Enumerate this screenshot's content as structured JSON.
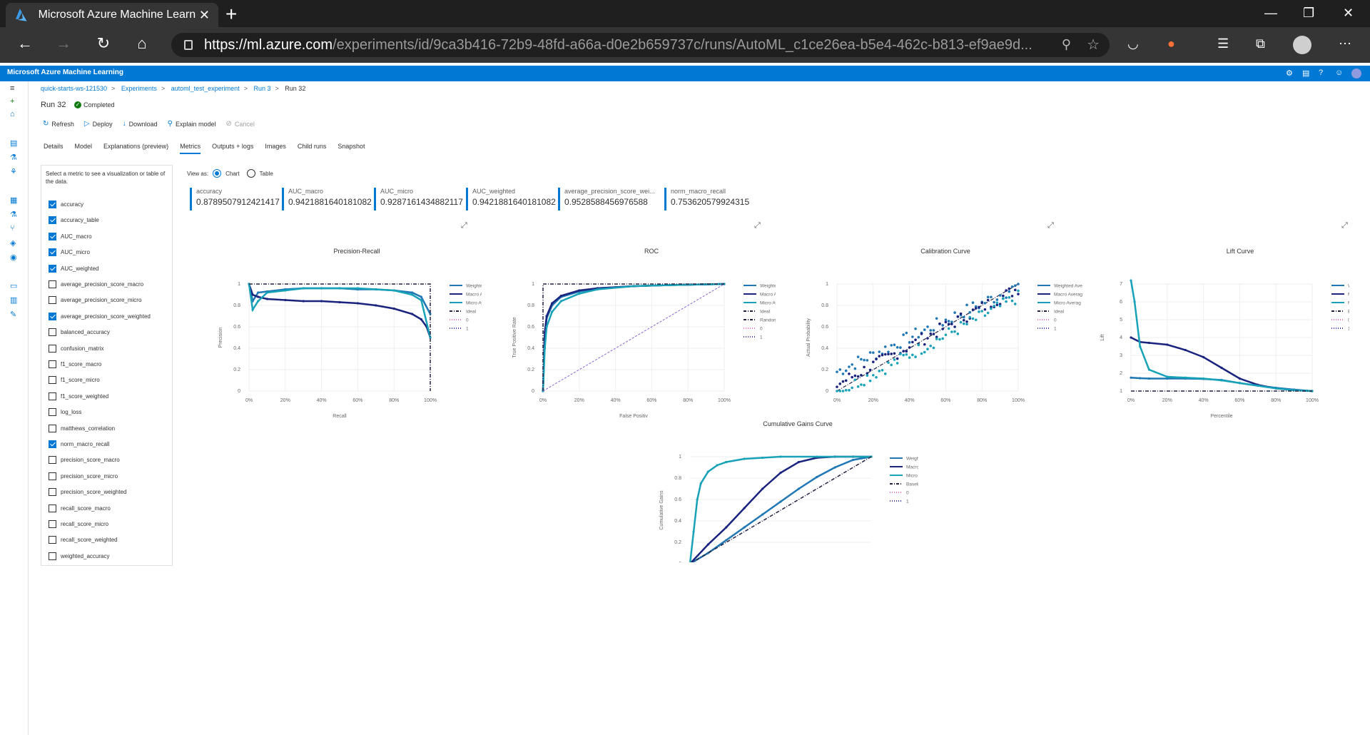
{
  "browser": {
    "tab_title": "Microsoft Azure Machine Learni",
    "url_host": "https://ml.azure.com",
    "url_path": "/experiments/id/9ca3b416-72b9-48fd-a66a-d0e2b659737c/runs/AutoML_c1ce26ea-b5e4-462c-b813-ef9ae9d..."
  },
  "header": {
    "brand": "Microsoft Azure Machine Learning"
  },
  "breadcrumb": [
    "quick-starts-ws-121530",
    "Experiments",
    "automl_test_experiment",
    "Run 3",
    "Run 32"
  ],
  "run": {
    "title": "Run 32",
    "status": "Completed"
  },
  "actions": {
    "refresh": "Refresh",
    "deploy": "Deploy",
    "download": "Download",
    "explain": "Explain model",
    "cancel": "Cancel"
  },
  "tabs": [
    "Details",
    "Model",
    "Explanations (preview)",
    "Metrics",
    "Outputs + logs",
    "Images",
    "Child runs",
    "Snapshot"
  ],
  "metrics_panel": {
    "description": "Select a metric to see a visualization or table of the data.",
    "items": [
      {
        "label": "accuracy",
        "checked": true
      },
      {
        "label": "accuracy_table",
        "checked": true
      },
      {
        "label": "AUC_macro",
        "checked": true
      },
      {
        "label": "AUC_micro",
        "checked": true
      },
      {
        "label": "AUC_weighted",
        "checked": true
      },
      {
        "label": "average_precision_score_macro",
        "checked": false
      },
      {
        "label": "average_precision_score_micro",
        "checked": false
      },
      {
        "label": "average_precision_score_weighted",
        "checked": true
      },
      {
        "label": "balanced_accuracy",
        "checked": false
      },
      {
        "label": "confusion_matrix",
        "checked": false
      },
      {
        "label": "f1_score_macro",
        "checked": false
      },
      {
        "label": "f1_score_micro",
        "checked": false
      },
      {
        "label": "f1_score_weighted",
        "checked": false
      },
      {
        "label": "log_loss",
        "checked": false
      },
      {
        "label": "matthews_correlation",
        "checked": false
      },
      {
        "label": "norm_macro_recall",
        "checked": true
      },
      {
        "label": "precision_score_macro",
        "checked": false
      },
      {
        "label": "precision_score_micro",
        "checked": false
      },
      {
        "label": "precision_score_weighted",
        "checked": false
      },
      {
        "label": "recall_score_macro",
        "checked": false
      },
      {
        "label": "recall_score_micro",
        "checked": false
      },
      {
        "label": "recall_score_weighted",
        "checked": false
      },
      {
        "label": "weighted_accuracy",
        "checked": false
      }
    ]
  },
  "view_as": {
    "label": "View as:",
    "chart": "Chart",
    "table": "Table",
    "selected": "Chart"
  },
  "metric_cards": [
    {
      "name": "accuracy",
      "value": "0.8789507912421417"
    },
    {
      "name": "AUC_macro",
      "value": "0.9421881640181082"
    },
    {
      "name": "AUC_micro",
      "value": "0.9287161434882117"
    },
    {
      "name": "AUC_weighted",
      "value": "0.9421881640181082"
    },
    {
      "name": "average_precision_score_wei...",
      "value": "0.9528588456976588"
    },
    {
      "name": "norm_macro_recall",
      "value": "0.753620579924315"
    }
  ],
  "colors": {
    "accent": "#0078d4",
    "weighted": "#1f77b4",
    "macro": "#1a237e",
    "micro": "#17a2b8",
    "baseline": "#222244",
    "zero": "#e377c2",
    "one": "#3f3f9f"
  },
  "chart_data": [
    {
      "type": "line",
      "title": "Precision-Recall",
      "xlabel": "Recall",
      "ylabel": "Precision",
      "x_ticks": [
        "0%",
        "20%",
        "40%",
        "60%",
        "80%",
        "100%"
      ],
      "y_ticks": [
        "0",
        "0.2",
        "0.4",
        "0.6",
        "0.8",
        "1"
      ],
      "legend": [
        "Weighted Ave",
        "Macro Averag",
        "Micro Averag",
        "Ideal",
        "0",
        "1"
      ],
      "series": [
        {
          "name": "Weighted Ave",
          "x": [
            0,
            0.02,
            0.05,
            0.1,
            0.2,
            0.3,
            0.4,
            0.5,
            0.6,
            0.7,
            0.8,
            0.9,
            0.95,
            1.0
          ],
          "y": [
            1,
            0.84,
            0.92,
            0.93,
            0.95,
            0.96,
            0.96,
            0.96,
            0.95,
            0.95,
            0.94,
            0.92,
            0.88,
            0.72
          ]
        },
        {
          "name": "Macro Averag",
          "x": [
            0,
            0.02,
            0.05,
            0.1,
            0.2,
            0.3,
            0.4,
            0.5,
            0.6,
            0.7,
            0.8,
            0.9,
            0.95,
            0.98,
            1.0
          ],
          "y": [
            1,
            0.9,
            0.88,
            0.86,
            0.85,
            0.84,
            0.84,
            0.83,
            0.82,
            0.8,
            0.77,
            0.72,
            0.67,
            0.6,
            0.5
          ]
        },
        {
          "name": "Micro Averag",
          "x": [
            0,
            0.02,
            0.05,
            0.1,
            0.2,
            0.3,
            0.4,
            0.5,
            0.6,
            0.7,
            0.8,
            0.9,
            0.95,
            1.0
          ],
          "y": [
            1,
            0.76,
            0.84,
            0.92,
            0.94,
            0.96,
            0.96,
            0.96,
            0.96,
            0.95,
            0.94,
            0.9,
            0.85,
            0.5
          ]
        },
        {
          "name": "Ideal",
          "x": [
            0,
            1,
            1
          ],
          "y": [
            1,
            1,
            0
          ]
        }
      ]
    },
    {
      "type": "line",
      "title": "ROC",
      "xlabel": "False Positiv",
      "ylabel": "True Positive Rate",
      "x_ticks": [
        "0%",
        "20%",
        "40%",
        "60%",
        "80%",
        "100%"
      ],
      "y_ticks": [
        "0",
        "0.2",
        "0.4",
        "0.6",
        "0.8",
        "1"
      ],
      "legend": [
        "Weighted Ave",
        "Macro Averag",
        "Micro Averag",
        "Ideal",
        "Random class",
        "0",
        "1"
      ],
      "series": [
        {
          "name": "Weighted Ave",
          "x": [
            0,
            0.01,
            0.02,
            0.05,
            0.1,
            0.2,
            0.3,
            0.5,
            0.7,
            1.0
          ],
          "y": [
            0,
            0.5,
            0.68,
            0.8,
            0.88,
            0.93,
            0.96,
            0.98,
            0.99,
            1.0
          ]
        },
        {
          "name": "Macro Averag",
          "x": [
            0,
            0.01,
            0.02,
            0.05,
            0.1,
            0.2,
            0.3,
            0.5,
            0.7,
            1.0
          ],
          "y": [
            0,
            0.55,
            0.7,
            0.82,
            0.89,
            0.94,
            0.96,
            0.98,
            0.99,
            1.0
          ]
        },
        {
          "name": "Micro Averag",
          "x": [
            0,
            0.01,
            0.02,
            0.05,
            0.1,
            0.2,
            0.3,
            0.5,
            0.7,
            1.0
          ],
          "y": [
            0,
            0.4,
            0.6,
            0.74,
            0.84,
            0.91,
            0.95,
            0.98,
            0.99,
            1.0
          ]
        },
        {
          "name": "Ideal",
          "x": [
            0,
            0,
            1
          ],
          "y": [
            0,
            1,
            1
          ]
        },
        {
          "name": "Random class",
          "x": [
            0,
            1
          ],
          "y": [
            0,
            1
          ]
        }
      ]
    },
    {
      "type": "scatter",
      "title": "Calibration Curve",
      "xlabel": "",
      "ylabel": "Actual Probability",
      "x_ticks": [
        "0%",
        "20%",
        "40%",
        "60%",
        "80%",
        "100%"
      ],
      "y_ticks": [
        "0",
        "0.2",
        "0.4",
        "0.6",
        "0.8",
        "1"
      ],
      "legend": [
        "Weighted Ave",
        "Macro Averag",
        "Micro Averag",
        "Ideal",
        "0",
        "1"
      ]
    },
    {
      "type": "line",
      "title": "Lift Curve",
      "xlabel": "Percentile",
      "ylabel": "Lift",
      "x_ticks": [
        "0%",
        "20%",
        "40%",
        "60%",
        "80%",
        "100%"
      ],
      "y_ticks": [
        "1",
        "2",
        "3",
        "4",
        "5",
        "6",
        "7"
      ],
      "legend": [
        "Weigh",
        "Macro",
        "Micro",
        "Baseli",
        "0",
        "1"
      ],
      "series": [
        {
          "name": "Weigh",
          "x": [
            0,
            0.05,
            0.1,
            0.2,
            0.3,
            0.4,
            0.5,
            0.6,
            0.7,
            0.8,
            0.9,
            1.0
          ],
          "y": [
            1.75,
            1.72,
            1.7,
            1.7,
            1.7,
            1.68,
            1.62,
            1.45,
            1.3,
            1.18,
            1.08,
            1.0
          ]
        },
        {
          "name": "Macro",
          "x": [
            0,
            0.05,
            0.1,
            0.2,
            0.3,
            0.4,
            0.5,
            0.6,
            0.7,
            0.8,
            0.9,
            1.0
          ],
          "y": [
            4.0,
            3.75,
            3.7,
            3.6,
            3.3,
            2.9,
            2.3,
            1.7,
            1.35,
            1.15,
            1.05,
            1.0
          ]
        },
        {
          "name": "Micro",
          "x": [
            0,
            0.02,
            0.05,
            0.1,
            0.2,
            0.3,
            0.4,
            0.5,
            0.6,
            0.7,
            0.8,
            0.9,
            1.0
          ],
          "y": [
            7.2,
            6.0,
            3.5,
            2.2,
            1.8,
            1.75,
            1.7,
            1.6,
            1.45,
            1.3,
            1.15,
            1.05,
            1.0
          ]
        },
        {
          "name": "Baseli",
          "x": [
            0,
            1
          ],
          "y": [
            1,
            1
          ]
        }
      ]
    },
    {
      "type": "line",
      "title": "Cumulative Gains Curve",
      "xlabel": "",
      "ylabel": "Cumulative Gains",
      "x_ticks": [],
      "y_ticks": [
        "0",
        "0.2",
        "0.4",
        "0.6",
        "0.8",
        "1"
      ],
      "legend": [
        "Weighted Average",
        "Macro Average",
        "Micro Average",
        "Baseline",
        "0",
        "1"
      ],
      "series": [
        {
          "name": "Weighted Average",
          "x": [
            0,
            0.1,
            0.2,
            0.3,
            0.4,
            0.5,
            0.6,
            0.7,
            0.8,
            0.9,
            1.0
          ],
          "y": [
            0,
            0.1,
            0.22,
            0.34,
            0.46,
            0.58,
            0.7,
            0.81,
            0.9,
            0.97,
            1.0
          ]
        },
        {
          "name": "Macro Average",
          "x": [
            0,
            0.1,
            0.2,
            0.3,
            0.4,
            0.5,
            0.6,
            0.7,
            0.8,
            0.9,
            1.0
          ],
          "y": [
            0,
            0.18,
            0.34,
            0.52,
            0.7,
            0.85,
            0.95,
            0.99,
            1.0,
            1.0,
            1.0
          ]
        },
        {
          "name": "Micro Average",
          "x": [
            0,
            0.02,
            0.04,
            0.06,
            0.1,
            0.15,
            0.2,
            0.3,
            0.4,
            0.5,
            0.7,
            1.0
          ],
          "y": [
            0,
            0.3,
            0.6,
            0.75,
            0.86,
            0.92,
            0.95,
            0.98,
            0.99,
            1.0,
            1.0,
            1.0
          ]
        },
        {
          "name": "Baseline",
          "x": [
            0,
            1
          ],
          "y": [
            0,
            1
          ]
        }
      ]
    }
  ]
}
